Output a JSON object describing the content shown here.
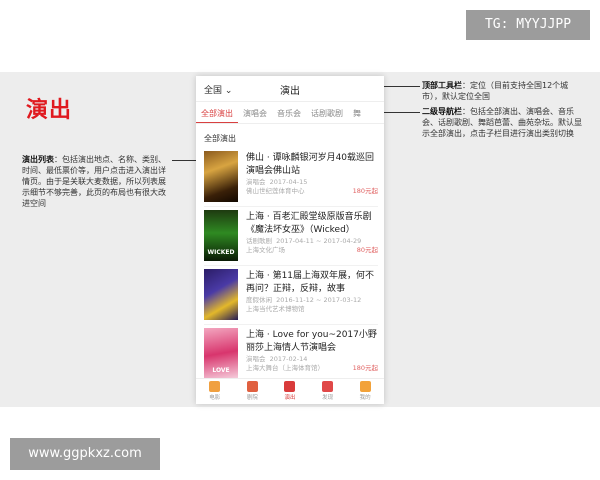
{
  "watermarks": {
    "top": "TG: MYYJJPP",
    "bottom": "www.ggpkxz.com"
  },
  "page_title": "演出",
  "annotations": {
    "left_label": "演出列表",
    "left_text": "：包括演出地点、名称、类别、时间、最低票价等，用户点击进入演出详情页。由于是关联大麦数据，所以列表展示细节不够完善，此页的布局也有很大改进空间",
    "right1_label": "顶部工具栏",
    "right1_text": "：定位（目前支持全国12个城市），默认定位全国",
    "right2_label": "二级导航栏",
    "right2_text": "：包括全部演出、演唱会、音乐会、话剧歌剧、舞蹈芭蕾、曲苑杂坛。默认显示全部演出，点击子栏目进行演出类别切换"
  },
  "app": {
    "city": "全国",
    "title": "演出",
    "tabs": [
      "全部演出",
      "演唱会",
      "音乐会",
      "话剧歌剧",
      "舞"
    ],
    "section_title": "全部演出",
    "items": [
      {
        "title": "佛山 · 谭咏麟银河岁月40载巡回演唱会佛山站",
        "category": "演唱会",
        "date": "2017-04-15",
        "venue": "佛山世纪莲体育中心",
        "price": "180元起",
        "poster_text": ""
      },
      {
        "title": "上海 · 百老汇殿堂级原版音乐剧《魔法坏女巫》（Wicked）",
        "category": "话剧歌剧",
        "date": "2017-04-11 ~ 2017-04-29",
        "venue": "上海文化广场",
        "price": "80元起",
        "poster_text": "WICKED"
      },
      {
        "title": "上海 · 第11届上海双年展，何不再问？正辩，反辩，故事",
        "category": "度假休闲",
        "date": "2016-11-12 ~ 2017-03-12",
        "venue": "上海当代艺术博物馆",
        "price": "",
        "poster_text": ""
      },
      {
        "title": "上海 · Love for you~2017小野丽莎上海情人节演唱会",
        "category": "演唱会",
        "date": "2017-02-14",
        "venue": "上海大舞台（上海体育馆）",
        "price": "180元起",
        "poster_text": "LOVE"
      }
    ],
    "tabbar": [
      "电影",
      "剧院",
      "演出",
      "发现",
      "我的"
    ]
  },
  "colors": {
    "accent": "#e0191f",
    "tab_active": "#d94040",
    "price": "#e06262"
  }
}
